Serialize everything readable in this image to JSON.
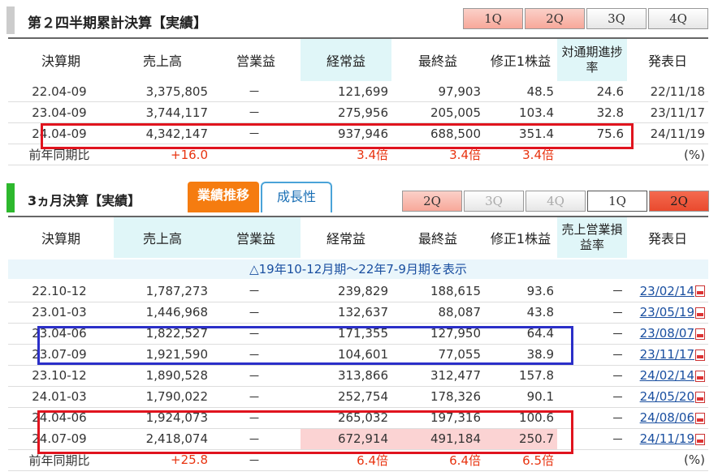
{
  "sec1": {
    "title": "第２四半期累計決算【実績】",
    "tabs": [
      "1Q",
      "2Q",
      "3Q",
      "4Q"
    ],
    "headers": [
      "決算期",
      "売上高",
      "営業益",
      "経常益",
      "最終益",
      "修正1株益",
      "対通期進捗率",
      "発表日"
    ],
    "rows": [
      [
        "22.04-09",
        "3,375,805",
        "－",
        "121,699",
        "97,903",
        "48.5",
        "24.6",
        "22/11/18"
      ],
      [
        "23.04-09",
        "3,744,117",
        "－",
        "275,956",
        "205,005",
        "103.4",
        "32.8",
        "23/11/17"
      ],
      [
        "24.04-09",
        "4,342,147",
        "－",
        "937,946",
        "688,500",
        "351.4",
        "75.6",
        "24/11/19"
      ]
    ],
    "yoy": [
      "前年同期比",
      "+16.0",
      "",
      "3.4倍",
      "3.4倍",
      "3.4倍",
      "",
      "(%)"
    ]
  },
  "sec2": {
    "title": "3ヵ月決算【実績】",
    "tab_active": "業績推移",
    "tab_other": "成長性",
    "tabs": [
      "2Q",
      "3Q",
      "4Q",
      "1Q",
      "2Q"
    ],
    "headers": [
      "決算期",
      "売上高",
      "営業益",
      "経常益",
      "最終益",
      "修正1株益",
      "売上営業損益率",
      "発表日"
    ],
    "note": "△19年10-12月期～22年7-9月期を表示",
    "rows": [
      [
        "22.10-12",
        "1,787,273",
        "－",
        "239,829",
        "188,615",
        "93.6",
        "－",
        "23/02/14"
      ],
      [
        "23.01-03",
        "1,446,968",
        "－",
        "132,637",
        "88,087",
        "43.8",
        "－",
        "23/05/19"
      ],
      [
        "23.04-06",
        "1,822,527",
        "－",
        "171,355",
        "127,950",
        "64.4",
        "－",
        "23/08/07"
      ],
      [
        "23.07-09",
        "1,921,590",
        "－",
        "104,601",
        "77,055",
        "38.9",
        "－",
        "23/11/17"
      ],
      [
        "23.10-12",
        "1,890,528",
        "－",
        "313,866",
        "312,477",
        "157.8",
        "－",
        "24/02/14"
      ],
      [
        "24.01-03",
        "1,790,022",
        "－",
        "252,754",
        "178,326",
        "90.1",
        "－",
        "24/05/20"
      ],
      [
        "24.04-06",
        "1,924,073",
        "－",
        "265,032",
        "197,316",
        "100.6",
        "－",
        "24/08/06"
      ],
      [
        "24.07-09",
        "2,418,074",
        "－",
        "672,914",
        "491,184",
        "250.7",
        "－",
        "24/11/19"
      ]
    ],
    "yoy": [
      "前年同期比",
      "+25.8",
      "－",
      "6.4倍",
      "6.4倍",
      "6.5倍",
      "",
      "(%)"
    ]
  }
}
